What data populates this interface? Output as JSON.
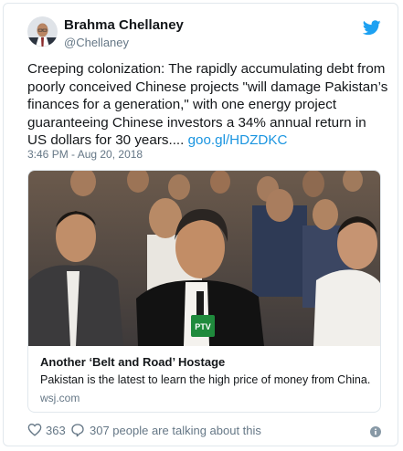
{
  "author": {
    "name": "Brahma Chellaney",
    "handle": "@Chellaney"
  },
  "tweet": {
    "text": "Creeping colonization: The rapidly accumulating debt from poorly conceived Chinese projects \"will damage Pakistan’s finances for a generation,\" with one energy project guaranteeing Chinese investors a 34% annual return in US dollars for 30 years.... ",
    "link": "goo.gl/HDZDKC",
    "timestamp": "3:46 PM - Aug 20, 2018"
  },
  "card": {
    "image_badge": "PTV",
    "title": "Another ‘Belt and Road’ Hostage",
    "description": "Pakistan is the latest to learn the high price of money from China.",
    "domain": "wsj.com"
  },
  "engagement": {
    "likes": "363",
    "talking": "307 people are talking about this"
  },
  "colors": {
    "link": "#1b95e0",
    "secondary_text": "#657786",
    "border": "#e1e8ed",
    "twitter_blue": "#1da1f2"
  },
  "icons": [
    "twitter-bird-icon",
    "heart-icon",
    "comment-icon",
    "info-icon"
  ]
}
